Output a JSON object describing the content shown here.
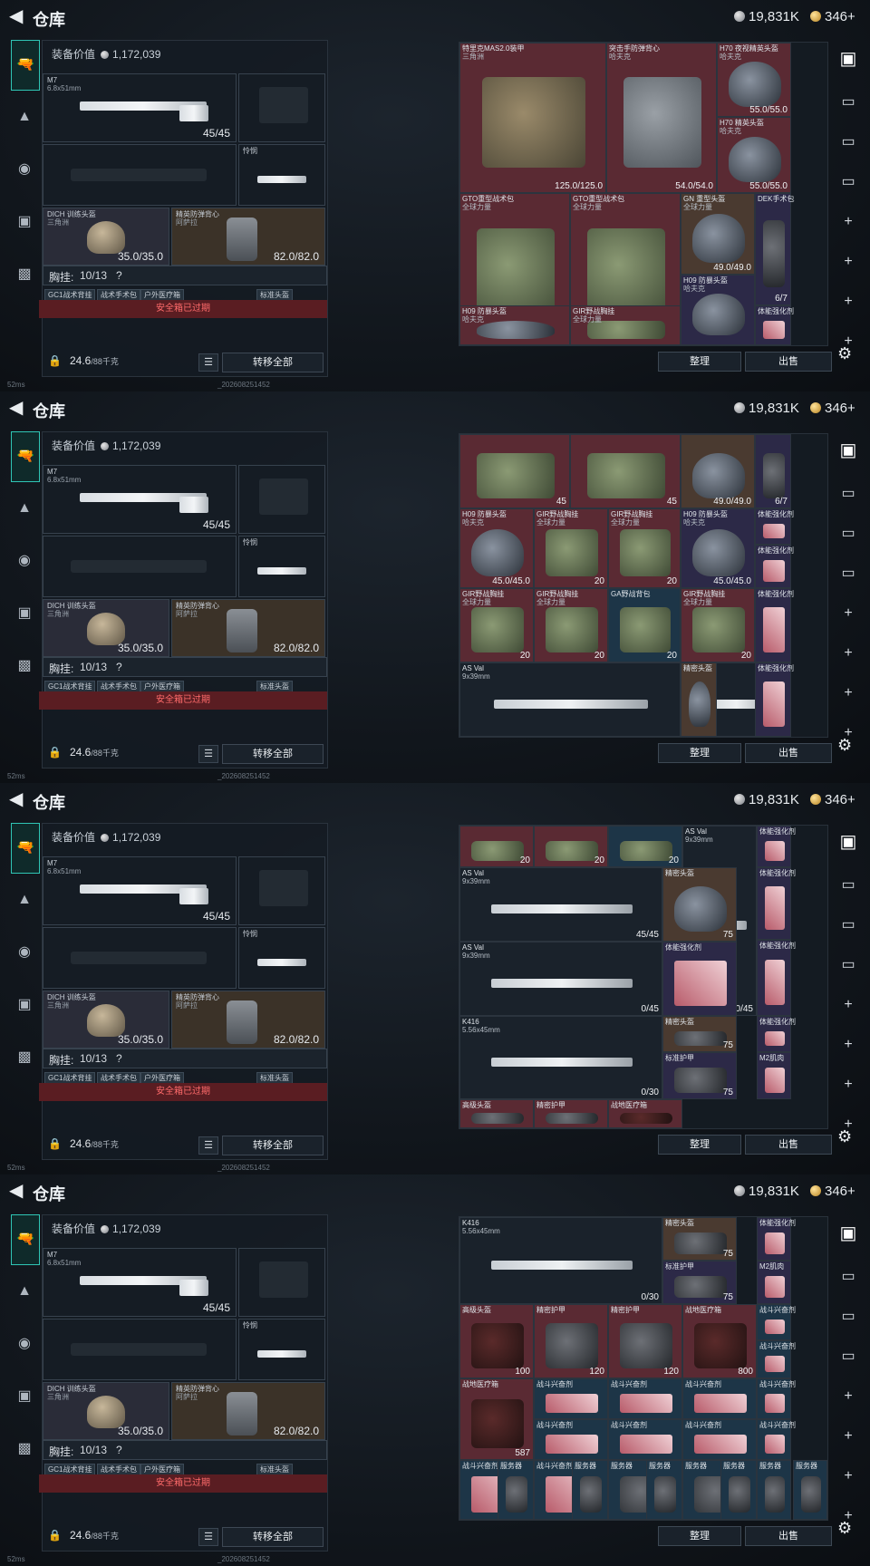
{
  "header": {
    "title": "仓库",
    "silver": "19,831K",
    "gold": "346+"
  },
  "equip": {
    "value_label": "装备价值",
    "value": "1,172,039",
    "primary": {
      "name": "M7",
      "caliber": "6.8x51mm",
      "ammo": "45/45"
    },
    "knife": {
      "name": "怜悯"
    },
    "helmet": {
      "name": "DICH 训练头盔",
      "sub": "三角洲",
      "durability": "35.0/35.0"
    },
    "armor": {
      "name": "精英防弹背心",
      "sub": "阿萨拉",
      "durability": "82.0/82.0"
    },
    "chest_label": "胸挂:",
    "chest_value": "10/13",
    "tags": [
      "GC1战术背挂",
      "战术手术包",
      "户外医疗箱",
      "标准头盔"
    ],
    "safe_box": "安全箱已过期",
    "weight": "24.6",
    "weight_max": "/88千克",
    "transfer_all": "转移全部"
  },
  "status": {
    "ping": "52ms",
    "build": "_202608251452"
  },
  "actions": {
    "sort": "整理",
    "sell": "出售"
  },
  "grids": [
    [
      {
        "name": "特里克MAS2.0装甲",
        "sub": "三角洲",
        "value": "125.0/125.0",
        "color": "red",
        "img": "armor"
      },
      {
        "name": "突击手防弹背心",
        "sub": "哈夫克",
        "value": "54.0/54.0",
        "color": "red",
        "img": "vestg"
      },
      {
        "name": "H70 夜视精英头盔",
        "sub": "哈夫克",
        "value": "55.0/55.0",
        "color": "red",
        "img": "helmetd"
      },
      {
        "name": "H70 精英头盔",
        "sub": "哈夫克",
        "value": "55.0/55.0",
        "color": "red",
        "img": "helmetd"
      },
      {
        "name": "GTO重型战术包",
        "sub": "全球力量",
        "value": "45",
        "color": "red",
        "img": "green"
      },
      {
        "name": "GTO重型战术包",
        "sub": "全球力量",
        "value": "45",
        "color": "red",
        "img": "green"
      },
      {
        "name": "GN 重型头盔",
        "sub": "全球力量",
        "value": "49.0/49.0",
        "color": "brown",
        "img": "helmetd"
      },
      {
        "name": "DEK手术包",
        "sub": "",
        "value": "6/7",
        "color": "purple",
        "img": "bag"
      },
      {
        "name": "H09 防暴头盔",
        "sub": "哈夫克",
        "value": "",
        "color": "purple",
        "img": "helmetd"
      },
      {
        "name": "H09 防暴头盔",
        "sub": "哈夫克",
        "value": "",
        "color": "red",
        "img": "helmetd"
      },
      {
        "name": "GIR野战胸挂",
        "sub": "全球力量",
        "value": "",
        "color": "red",
        "img": "green"
      },
      {
        "name": "GIR野战胸挂",
        "sub": "全球力量",
        "value": "",
        "color": "red",
        "img": "green"
      },
      {
        "name": "体能强化剂",
        "sub": "",
        "value": "",
        "color": "purple",
        "img": "syr"
      }
    ],
    [
      {
        "name": "",
        "sub": "",
        "value": "45",
        "color": "red",
        "img": "green"
      },
      {
        "name": "",
        "sub": "",
        "value": "45",
        "color": "red",
        "img": "green"
      },
      {
        "name": "",
        "sub": "",
        "value": "49.0/49.0",
        "color": "brown",
        "img": "helmetd"
      },
      {
        "name": "",
        "sub": "",
        "value": "6/7",
        "color": "purple",
        "img": "bag"
      },
      {
        "name": "H09 防暴头盔",
        "sub": "哈夫克",
        "value": "45.0/45.0",
        "color": "purple",
        "img": "helmetd"
      },
      {
        "name": "体能强化剂",
        "sub": "",
        "value": "",
        "color": "purple",
        "img": "syr"
      },
      {
        "name": "H09 防暴头盔",
        "sub": "哈夫克",
        "value": "45.0/45.0",
        "color": "red",
        "img": "helmetd"
      },
      {
        "name": "GIR野战胸挂",
        "sub": "全球力量",
        "value": "20",
        "color": "red",
        "img": "green"
      },
      {
        "name": "GIR野战胸挂",
        "sub": "全球力量",
        "value": "20",
        "color": "red",
        "img": "green"
      },
      {
        "name": "GIR野战胸挂",
        "sub": "全球力量",
        "value": "20",
        "color": "red",
        "img": "green"
      },
      {
        "name": "体能强化剂",
        "sub": "",
        "value": "",
        "color": "purple",
        "img": "syr"
      },
      {
        "name": "GIR野战胸挂",
        "sub": "全球力量",
        "value": "20",
        "color": "red",
        "img": "green"
      },
      {
        "name": "GIR野战胸挂",
        "sub": "全球力量",
        "value": "20",
        "color": "red",
        "img": "green"
      },
      {
        "name": "GA野战背包",
        "sub": "",
        "value": "20",
        "color": "blue",
        "img": "green"
      },
      {
        "name": "AS Val",
        "sub": "9x39mm",
        "value": "",
        "color": "",
        "img": "gun"
      },
      {
        "name": "体能强化剂",
        "sub": "",
        "value": "",
        "color": "purple",
        "img": "syr"
      },
      {
        "name": "AS Val",
        "sub": "9x39mm",
        "value": "",
        "color": "",
        "img": "gun"
      },
      {
        "name": "精密头盔",
        "sub": "",
        "value": "",
        "color": "brown",
        "img": "helmetd"
      },
      {
        "name": "体能强化剂",
        "sub": "",
        "value": "",
        "color": "purple",
        "img": "syr"
      }
    ],
    [
      {
        "name": "",
        "sub": "",
        "value": "20",
        "color": "red",
        "img": "green"
      },
      {
        "name": "",
        "sub": "",
        "value": "20",
        "color": "red",
        "img": "green"
      },
      {
        "name": "",
        "sub": "",
        "value": "20",
        "color": "blue",
        "img": "green"
      },
      {
        "name": "AS Val",
        "sub": "9x39mm",
        "value": "0/45",
        "color": "",
        "img": "gun"
      },
      {
        "name": "体能强化剂",
        "sub": "",
        "value": "",
        "color": "purple",
        "img": "syr"
      },
      {
        "name": "AS Val",
        "sub": "9x39mm",
        "value": "45/45",
        "color": "",
        "img": "gun"
      },
      {
        "name": "精密头盔",
        "sub": "",
        "value": "75",
        "color": "brown",
        "img": "helmetd"
      },
      {
        "name": "体能强化剂",
        "sub": "",
        "value": "",
        "color": "purple",
        "img": "syr"
      },
      {
        "name": "AS Val",
        "sub": "9x39mm",
        "value": "0/45",
        "color": "",
        "img": "gun"
      },
      {
        "name": "体能强化剂",
        "sub": "",
        "value": "",
        "color": "purple",
        "img": "syr"
      },
      {
        "name": "体能强化剂",
        "sub": "",
        "value": "",
        "color": "purple",
        "img": "syr"
      },
      {
        "name": "K416",
        "sub": "5.56x45mm",
        "value": "0/30",
        "color": "",
        "img": "gun"
      },
      {
        "name": "精密头盔",
        "sub": "",
        "value": "75",
        "color": "brown",
        "img": "bag"
      },
      {
        "name": "体能强化剂",
        "sub": "",
        "value": "",
        "color": "purple",
        "img": "syr"
      },
      {
        "name": "标准护甲",
        "sub": "",
        "value": "75",
        "color": "purple",
        "img": "bag"
      },
      {
        "name": "M2肌肉",
        "sub": "",
        "value": "",
        "color": "purple",
        "img": "syr"
      },
      {
        "name": "高级头盔",
        "sub": "",
        "value": "",
        "color": "red",
        "img": "bag"
      },
      {
        "name": "精密护甲",
        "sub": "",
        "value": "",
        "color": "red",
        "img": "bag"
      },
      {
        "name": "战地医疗箱",
        "sub": "",
        "value": "",
        "color": "red",
        "img": "med"
      }
    ],
    [
      {
        "name": "K416",
        "sub": "5.56x45mm",
        "value": "0/30",
        "color": "",
        "img": "gun"
      },
      {
        "name": "精密头盔",
        "sub": "",
        "value": "75",
        "color": "brown",
        "img": "bag"
      },
      {
        "name": "体能强化剂",
        "sub": "",
        "value": "",
        "color": "purple",
        "img": "syr"
      },
      {
        "name": "标准护甲",
        "sub": "",
        "value": "75",
        "color": "purple",
        "img": "bag"
      },
      {
        "name": "M2肌肉",
        "sub": "",
        "value": "",
        "color": "purple",
        "img": "syr"
      },
      {
        "name": "高级头盔",
        "sub": "",
        "value": "100",
        "color": "red",
        "img": "med"
      },
      {
        "name": "精密护甲",
        "sub": "",
        "value": "120",
        "color": "red",
        "img": "bag"
      },
      {
        "name": "精密护甲",
        "sub": "",
        "value": "120",
        "color": "red",
        "img": "bag"
      },
      {
        "name": "战地医疗箱",
        "sub": "",
        "value": "800",
        "color": "red",
        "img": "med"
      },
      {
        "name": "战斗兴奋剂",
        "sub": "",
        "value": "",
        "color": "blue",
        "img": "syr"
      },
      {
        "name": "战地医疗箱",
        "sub": "",
        "value": "587",
        "color": "red",
        "img": "med"
      },
      {
        "name": "战斗兴奋剂",
        "sub": "",
        "value": "",
        "color": "blue",
        "img": "syr"
      },
      {
        "name": "战斗兴奋剂",
        "sub": "",
        "value": "",
        "color": "blue",
        "img": "syr"
      },
      {
        "name": "战斗兴奋剂",
        "sub": "",
        "value": "",
        "color": "blue",
        "img": "syr"
      },
      {
        "name": "战斗兴奋剂",
        "sub": "",
        "value": "",
        "color": "blue",
        "img": "syr"
      },
      {
        "name": "战斗兴奋剂",
        "sub": "",
        "value": "",
        "color": "blue",
        "img": "syr"
      },
      {
        "name": "战斗兴奋剂",
        "sub": "",
        "value": "",
        "color": "blue",
        "img": "syr"
      },
      {
        "name": "战斗兴奋剂",
        "sub": "",
        "value": "",
        "color": "blue",
        "img": "syr"
      },
      {
        "name": "战斗兴奋剂",
        "sub": "",
        "value": "",
        "color": "blue",
        "img": "syr"
      },
      {
        "name": "战斗兴奋剂",
        "sub": "",
        "value": "",
        "color": "blue",
        "img": "syr"
      },
      {
        "name": "战斗兴奋剂",
        "sub": "",
        "value": "",
        "color": "blue",
        "img": "syr"
      },
      {
        "name": "战斗兴奋剂",
        "sub": "",
        "value": "",
        "color": "blue",
        "img": "syr"
      },
      {
        "name": "服务器",
        "sub": "",
        "value": "",
        "color": "blue",
        "img": "bag"
      },
      {
        "name": "服务器",
        "sub": "",
        "value": "",
        "color": "blue",
        "img": "bag"
      },
      {
        "name": "服务器",
        "sub": "",
        "value": "",
        "color": "blue",
        "img": "bag"
      },
      {
        "name": "服务器",
        "sub": "",
        "value": "",
        "color": "blue",
        "img": "bag"
      },
      {
        "name": "服务器",
        "sub": "",
        "value": "",
        "color": "blue",
        "img": "bag"
      },
      {
        "name": "服务器",
        "sub": "",
        "value": "",
        "color": "blue",
        "img": "bag"
      },
      {
        "name": "服务器",
        "sub": "",
        "value": "",
        "color": "blue",
        "img": "bag"
      },
      {
        "name": "服务器",
        "sub": "",
        "value": "",
        "color": "blue",
        "img": "bag"
      }
    ]
  ],
  "icons": {
    "back": "back-arrow-icon",
    "nav": [
      "pistol-icon",
      "armor-icon",
      "helmet-icon",
      "backpack-icon",
      "briefcase-icon"
    ],
    "right": [
      "stash-icon",
      "tab-icon",
      "tab-icon",
      "tab-icon",
      "add-icon",
      "add-icon",
      "add-icon",
      "add-icon"
    ],
    "settings": "gear-icon"
  }
}
